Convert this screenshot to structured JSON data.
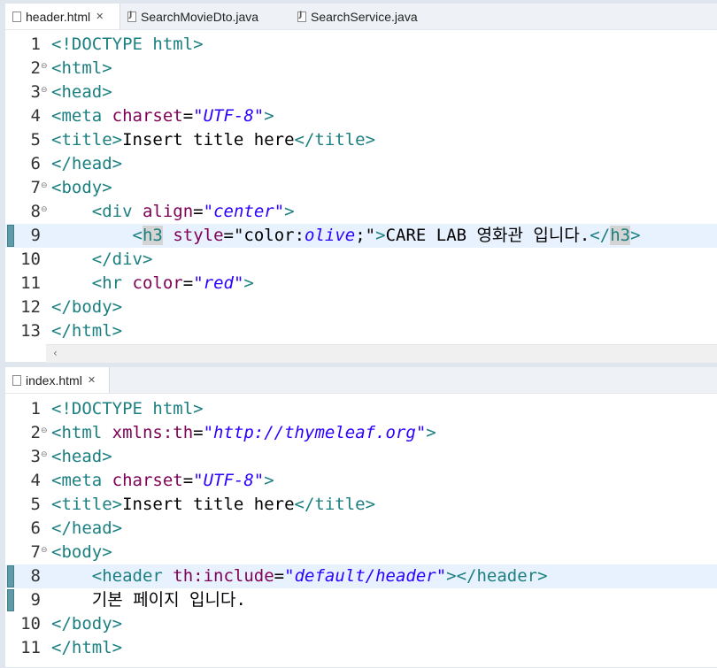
{
  "pane1": {
    "tabs": [
      {
        "label": "header.html",
        "active": true,
        "closable": true,
        "icon": "html-file-icon"
      },
      {
        "label": "SearchMovieDto.java",
        "active": false,
        "closable": false,
        "icon": "java-file-icon"
      },
      {
        "label": "SearchService.java",
        "active": false,
        "closable": false,
        "icon": "java-file-icon"
      }
    ],
    "lines": [
      {
        "n": "1",
        "fold": "",
        "mark": false,
        "tokens": [
          [
            "tg",
            "<!DOCTYPE html>"
          ]
        ]
      },
      {
        "n": "2",
        "fold": "⊖",
        "mark": false,
        "tokens": [
          [
            "tg",
            "<html>"
          ]
        ]
      },
      {
        "n": "3",
        "fold": "⊖",
        "mark": false,
        "tokens": [
          [
            "tg",
            "<head>"
          ]
        ]
      },
      {
        "n": "4",
        "fold": "",
        "mark": false,
        "tokens": [
          [
            "tg",
            "<meta "
          ],
          [
            "at",
            "charset"
          ],
          [
            "tx",
            "="
          ],
          [
            "sv",
            "\"UTF-8\""
          ],
          [
            "tg",
            ">"
          ]
        ]
      },
      {
        "n": "5",
        "fold": "",
        "mark": false,
        "tokens": [
          [
            "tg",
            "<title>"
          ],
          [
            "tx",
            "Insert title here"
          ],
          [
            "tg",
            "</title>"
          ]
        ]
      },
      {
        "n": "6",
        "fold": "",
        "mark": false,
        "tokens": [
          [
            "tg",
            "</head>"
          ]
        ]
      },
      {
        "n": "7",
        "fold": "⊖",
        "mark": false,
        "tokens": [
          [
            "tg",
            "<body>"
          ]
        ]
      },
      {
        "n": "8",
        "fold": "⊖",
        "mark": false,
        "tokens": [
          [
            "tx",
            "    "
          ],
          [
            "tg",
            "<div "
          ],
          [
            "at",
            "align"
          ],
          [
            "tx",
            "="
          ],
          [
            "sv",
            "\"center\""
          ],
          [
            "tg",
            ">"
          ]
        ]
      },
      {
        "n": "9",
        "fold": "",
        "mark": true,
        "current": true,
        "tokens": [
          [
            "tx",
            "        "
          ],
          [
            "tg",
            "<"
          ],
          [
            "tghl",
            "h3"
          ],
          [
            "tg",
            " "
          ],
          [
            "at",
            "style"
          ],
          [
            "tx",
            "=\"color:"
          ],
          [
            "svi",
            "olive"
          ],
          [
            "tx",
            ";\""
          ],
          [
            "tg",
            ">"
          ],
          [
            "tx",
            "CARE LAB 영화관 입니다."
          ],
          [
            "tg",
            "</"
          ],
          [
            "tghl",
            "h3"
          ],
          [
            "tg",
            ">"
          ]
        ]
      },
      {
        "n": "10",
        "fold": "",
        "mark": false,
        "tokens": [
          [
            "tx",
            "    "
          ],
          [
            "tg",
            "</div>"
          ]
        ]
      },
      {
        "n": "11",
        "fold": "",
        "mark": false,
        "tokens": [
          [
            "tx",
            "    "
          ],
          [
            "tg",
            "<hr "
          ],
          [
            "at",
            "color"
          ],
          [
            "tx",
            "="
          ],
          [
            "sv",
            "\"red\""
          ],
          [
            "tg",
            ">"
          ]
        ]
      },
      {
        "n": "12",
        "fold": "",
        "mark": false,
        "tokens": [
          [
            "tg",
            "</body>"
          ]
        ]
      },
      {
        "n": "13",
        "fold": "",
        "mark": false,
        "tokens": [
          [
            "tg",
            "</html>"
          ]
        ]
      }
    ]
  },
  "pane2": {
    "tabs": [
      {
        "label": "index.html",
        "active": true,
        "closable": true,
        "icon": "html-file-icon"
      }
    ],
    "lines": [
      {
        "n": "1",
        "fold": "",
        "mark": false,
        "tokens": [
          [
            "tg",
            "<!DOCTYPE html>"
          ]
        ]
      },
      {
        "n": "2",
        "fold": "⊖",
        "mark": false,
        "tokens": [
          [
            "tg",
            "<html "
          ],
          [
            "at",
            "xmlns:th"
          ],
          [
            "tx",
            "="
          ],
          [
            "sv",
            "\"http://thymeleaf.org\""
          ],
          [
            "tg",
            ">"
          ]
        ]
      },
      {
        "n": "3",
        "fold": "⊖",
        "mark": false,
        "tokens": [
          [
            "tg",
            "<head>"
          ]
        ]
      },
      {
        "n": "4",
        "fold": "",
        "mark": false,
        "tokens": [
          [
            "tg",
            "<meta "
          ],
          [
            "at",
            "charset"
          ],
          [
            "tx",
            "="
          ],
          [
            "sv",
            "\"UTF-8\""
          ],
          [
            "tg",
            ">"
          ]
        ]
      },
      {
        "n": "5",
        "fold": "",
        "mark": false,
        "tokens": [
          [
            "tg",
            "<title>"
          ],
          [
            "tx",
            "Insert title here"
          ],
          [
            "tg",
            "</title>"
          ]
        ]
      },
      {
        "n": "6",
        "fold": "",
        "mark": false,
        "tokens": [
          [
            "tg",
            "</head>"
          ]
        ]
      },
      {
        "n": "7",
        "fold": "⊖",
        "mark": false,
        "tokens": [
          [
            "tg",
            "<body>"
          ]
        ]
      },
      {
        "n": "8",
        "fold": "",
        "mark": true,
        "current": true,
        "tokens": [
          [
            "tx",
            "    "
          ],
          [
            "tg",
            "<header "
          ],
          [
            "at",
            "th:include"
          ],
          [
            "tx",
            "="
          ],
          [
            "sv",
            "\"default/header\""
          ],
          [
            "tg",
            "></header>"
          ]
        ]
      },
      {
        "n": "9",
        "fold": "",
        "mark": true,
        "tokens": [
          [
            "tx",
            "    기본 페이지 입니다."
          ]
        ]
      },
      {
        "n": "10",
        "fold": "",
        "mark": false,
        "tokens": [
          [
            "tg",
            "</body>"
          ]
        ]
      },
      {
        "n": "11",
        "fold": "",
        "mark": false,
        "tokens": [
          [
            "tg",
            "</html>"
          ]
        ]
      }
    ]
  },
  "colors": {
    "tag": "#1b7f80",
    "attr": "#7f0055",
    "string": "#2a00ff",
    "current_line": "#e8f2fe",
    "change_marker": "#5f9aa6"
  },
  "scroll_left_icon": "chevron-left-icon"
}
